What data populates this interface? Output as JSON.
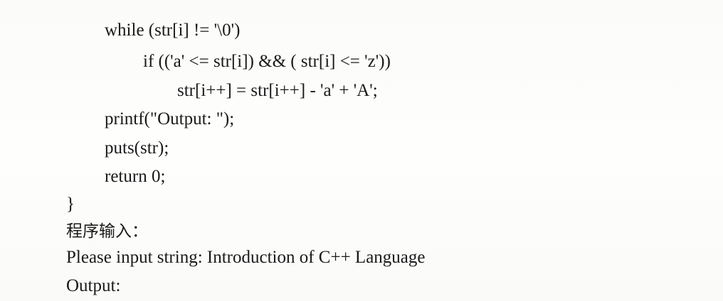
{
  "document": {
    "code_lines": [
      "while (str[i] != '\\0')",
      "if (('a' <= str[i]) && ( str[i] <= 'z'))",
      "str[i++] = str[i++] - 'a' + 'A';",
      "printf(\"Output: \");",
      "puts(str);",
      "return 0;",
      "}"
    ],
    "input_heading": "程序输入：",
    "input_line": "Please input string: Introduction of C++ Language",
    "output_line": "Output:"
  }
}
